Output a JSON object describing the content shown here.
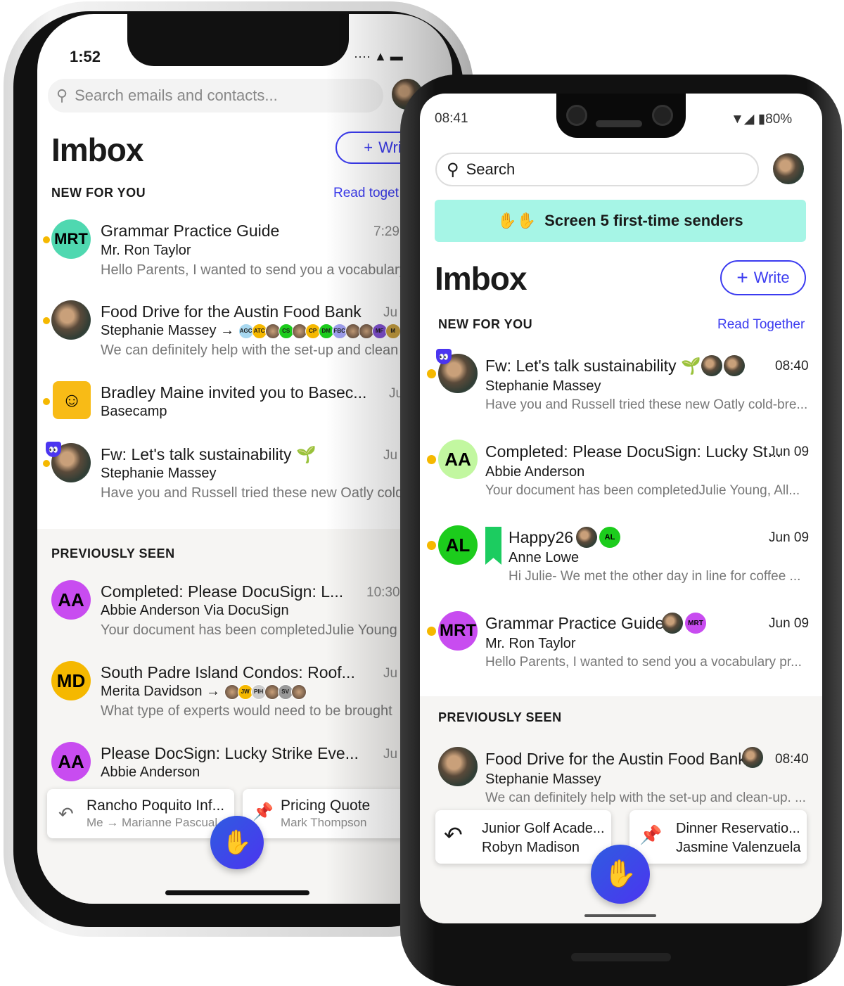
{
  "colors": {
    "accent": "#3b3bf0",
    "unread_dot": "#f5b800",
    "banner": "#a6f5e6",
    "fab": "#3d48e8"
  },
  "left": {
    "status": {
      "time": "1:52"
    },
    "search_placeholder": "Search emails and contacts...",
    "title": "Imbox",
    "write": "Writ",
    "new_for_you": "NEW FOR YOU",
    "read_together": "Read toget",
    "new_rows": [
      {
        "initials": "MRT",
        "avatar_color": "#4fd8b0",
        "title": "Grammar Practice Guide",
        "time": "7:29",
        "sender": "Mr. Ron Taylor",
        "preview": "Hello Parents, I wanted to send you a vocabulary"
      },
      {
        "title": "Food Drive for the Austin Food Bank",
        "time": "Ju",
        "sender": "Stephanie Massey →",
        "chips": [
          "AGC",
          "ATC",
          "",
          "CS",
          "",
          "CP",
          "DM",
          "FBC",
          "",
          "",
          "MF",
          "M"
        ],
        "preview": "We can definitely help with the set-up and clean"
      },
      {
        "title": "Bradley Maine invited you to Basec...",
        "time": "Ju",
        "sender": "Basecamp",
        "icon": "basecamp-icon"
      },
      {
        "title": "Fw: Let's talk sustainability 🌱",
        "time": "Ju",
        "sender": "Stephanie Massey",
        "preview": "Have you and Russell tried these new Oatly cold"
      }
    ],
    "previously_seen": "PREVIOUSLY SEEN",
    "seen_rows": [
      {
        "initials": "AA",
        "avatar_color": "#c84cf0",
        "title": "Completed: Please DocuSign: L...",
        "time": "10:30",
        "sender": "Abbie Anderson Via DocuSign",
        "preview": "Your document has been completedJulie Young"
      },
      {
        "initials": "MD",
        "avatar_color": "#f5b800",
        "title": "South Padre Island Condos: Roof...",
        "time": "Ju",
        "sender": "Merita Davidson →",
        "chips": [
          "",
          "JW",
          "PIH",
          "",
          "SV",
          ""
        ],
        "preview": "What type of experts would need to be brought"
      },
      {
        "initials": "AA",
        "avatar_color": "#c84cf0",
        "title": "Please DocSign: Lucky Strike Eve...",
        "time": "Ju",
        "sender": "Abbie Anderson"
      }
    ],
    "cards": [
      {
        "title": "Rancho Poquito Inf...",
        "sub": "Me → Marianne Pascual",
        "icon": "reply-later-icon"
      },
      {
        "title": "Pricing Quote",
        "sub": "Mark Thompson",
        "icon": "pin-icon"
      }
    ]
  },
  "right": {
    "status": {
      "time": "08:41",
      "battery": "80%"
    },
    "search_placeholder": "Search",
    "banner": "Screen 5 first-time senders",
    "title": "Imbox",
    "write": "Write",
    "new_for_you": "NEW FOR YOU",
    "read_together": "Read Together",
    "new_rows": [
      {
        "title": "Fw: Let's talk sustainability 🌱",
        "time": "08:40",
        "sender": "Stephanie Massey",
        "preview": "Have you and Russell tried these new Oatly cold-bre..."
      },
      {
        "initials": "AA",
        "avatar_color": "#c2f7a0",
        "title": "Completed: Please DocuSign: Lucky St...",
        "time": "Jun 09",
        "sender": "Abbie Anderson",
        "preview": "Your document has been completedJulie Young, All..."
      },
      {
        "initials": "AL",
        "avatar_color": "#1ccc1c",
        "title": "Happy26",
        "time": "Jun 09",
        "sender": "Anne Lowe",
        "chip": "AL",
        "preview": "Hi Julie- We met the other day in line for coffee ..."
      },
      {
        "initials": "MRT",
        "avatar_color": "#c84cf0",
        "title": "Grammar Practice Guide",
        "time": "Jun 09",
        "sender": "Mr. Ron Taylor",
        "chip": "MRT",
        "preview": "Hello Parents, I wanted to send you a vocabulary pr..."
      }
    ],
    "previously_seen": "PREVIOUSLY SEEN",
    "seen_rows": [
      {
        "title": "Food Drive for the Austin Food Bank",
        "time": "08:40",
        "sender": "Stephanie Massey",
        "preview": "We can definitely help with the set-up and clean-up. ..."
      }
    ],
    "cards": [
      {
        "title": "Junior Golf Acade...",
        "sub": "Robyn Madison",
        "icon": "reply-later-icon"
      },
      {
        "title": "Dinner Reservatio...",
        "sub": "Jasmine Valenzuela",
        "icon": "pin-icon"
      }
    ]
  }
}
